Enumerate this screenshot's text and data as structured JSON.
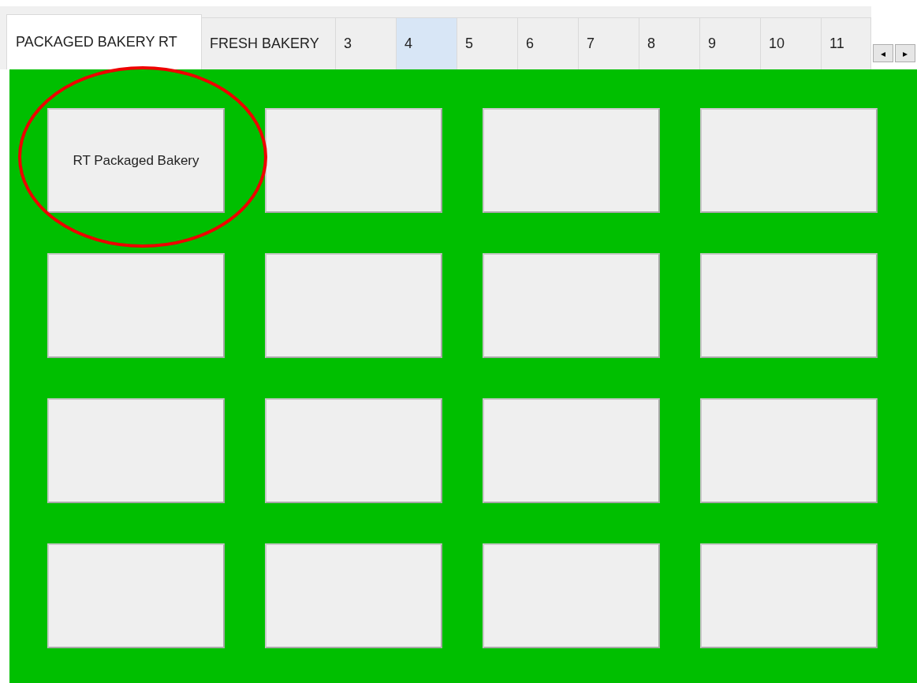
{
  "tabs": [
    {
      "label": "PACKAGED BAKERY RT",
      "selected": true,
      "hovered": false
    },
    {
      "label": "FRESH BAKERY",
      "selected": false,
      "hovered": false
    },
    {
      "label": "3",
      "selected": false,
      "hovered": false
    },
    {
      "label": "4",
      "selected": false,
      "hovered": true
    },
    {
      "label": "5",
      "selected": false,
      "hovered": false
    },
    {
      "label": "6",
      "selected": false,
      "hovered": false
    },
    {
      "label": "7",
      "selected": false,
      "hovered": false
    },
    {
      "label": "8",
      "selected": false,
      "hovered": false
    },
    {
      "label": "9",
      "selected": false,
      "hovered": false
    },
    {
      "label": "10",
      "selected": false,
      "hovered": false
    },
    {
      "label": "11",
      "selected": false,
      "hovered": false
    }
  ],
  "tab_scroll": {
    "left": "◂",
    "right": "▸"
  },
  "buttons": [
    {
      "kind": "labeled",
      "label": "RT Packaged Bakery"
    },
    {
      "kind": "blank"
    },
    {
      "kind": "blank"
    },
    {
      "kind": "blank"
    },
    {
      "kind": "blank"
    },
    {
      "kind": "blank"
    },
    {
      "kind": "blank"
    },
    {
      "kind": "blank"
    },
    {
      "kind": "blank"
    },
    {
      "kind": "blank"
    },
    {
      "kind": "blank"
    },
    {
      "kind": "blank"
    },
    {
      "kind": "blank"
    },
    {
      "kind": "blank"
    },
    {
      "kind": "blank"
    },
    {
      "kind": "blank"
    }
  ],
  "markup_ellipse": true
}
